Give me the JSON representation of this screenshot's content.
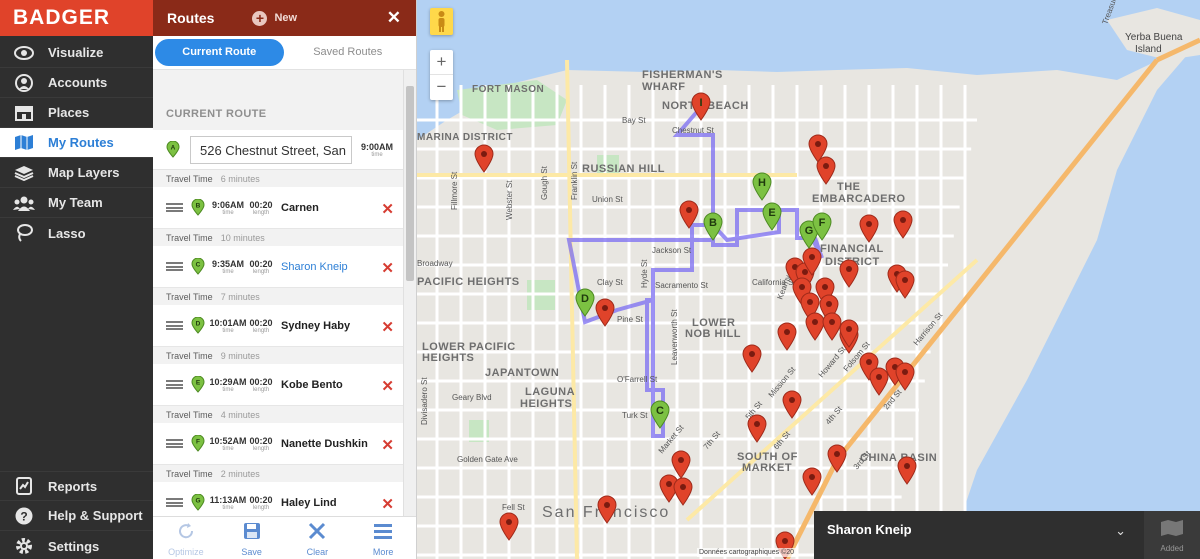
{
  "app": {
    "logo": "BADGER",
    "accent_color": "#e0432a"
  },
  "nav": {
    "items": [
      {
        "label": "Visualize",
        "icon": "eye-icon"
      },
      {
        "label": "Accounts",
        "icon": "user-circle-icon"
      },
      {
        "label": "Places",
        "icon": "storefront-icon"
      },
      {
        "label": "My Routes",
        "icon": "map-icon",
        "active": true
      },
      {
        "label": "Map Layers",
        "icon": "layers-icon"
      },
      {
        "label": "My Team",
        "icon": "team-icon"
      },
      {
        "label": "Lasso",
        "icon": "lasso-icon"
      }
    ],
    "bottom": [
      {
        "label": "Reports",
        "icon": "reports-icon"
      },
      {
        "label": "Help & Support",
        "icon": "help-icon"
      },
      {
        "label": "Settings",
        "icon": "gear-icon"
      }
    ]
  },
  "panel": {
    "title": "Routes",
    "new_label": "New",
    "close_symbol": "✕",
    "tabs": [
      {
        "label": "Current Route",
        "active": true
      },
      {
        "label": "Saved Routes",
        "active": false
      }
    ],
    "section_title": "CURRENT ROUTE",
    "start": {
      "marker": "A",
      "address": "526 Chestnut Street, San",
      "time": "9:00AM",
      "time_sub": "time"
    },
    "travel_label": "Travel Time",
    "stops": [
      {
        "travel": "6 minutes",
        "marker": "B",
        "time": "9:06AM",
        "length": "00:20",
        "name": "Carnen",
        "link": false
      },
      {
        "travel": "10 minutes",
        "marker": "C",
        "time": "9:35AM",
        "length": "00:20",
        "name": "Sharon Kneip",
        "link": true
      },
      {
        "travel": "7 minutes",
        "marker": "D",
        "time": "10:01AM",
        "length": "00:20",
        "name": "Sydney Haby",
        "link": false
      },
      {
        "travel": "9 minutes",
        "marker": "E",
        "time": "10:29AM",
        "length": "00:20",
        "name": "Kobe Bento",
        "link": false
      },
      {
        "travel": "4 minutes",
        "marker": "F",
        "time": "10:52AM",
        "length": "00:20",
        "name": "Nanette Dushkin",
        "link": false
      },
      {
        "travel": "2 minutes",
        "marker": "G",
        "time": "11:13AM",
        "length": "00:20",
        "name": "Haley Lind",
        "link": false
      }
    ],
    "time_sub": "time",
    "length_sub": "length",
    "footer": [
      {
        "label": "Optimize",
        "icon": "refresh-icon",
        "disabled": true
      },
      {
        "label": "Save",
        "icon": "save-icon",
        "disabled": false
      },
      {
        "label": "Clear",
        "icon": "clear-icon",
        "disabled": false
      },
      {
        "label": "More",
        "icon": "menu-icon",
        "disabled": false
      }
    ]
  },
  "map": {
    "zoom_in": "+",
    "zoom_out": "−",
    "attribution": "Données cartographiques ©20",
    "labels": [
      "FISHERMAN'S",
      "WHARF",
      "FORT MASON",
      "NORTH BEACH",
      "MARINA DISTRICT",
      "RUSSIAN HILL",
      "THE",
      "EMBARCADERO",
      "FINANCIAL",
      "DISTRICT",
      "PACIFIC HEIGHTS",
      "LOWER",
      "NOB HILL",
      "LOWER PACIFIC",
      "HEIGHTS",
      "JAPANTOWN",
      "LAGUNA",
      "HEIGHTS",
      "SOUTH OF",
      "MARKET",
      "CHINA BASIN",
      "San Francisco",
      "Yerba Buena",
      "Island",
      "Bay St",
      "Chestnut St",
      "Union St",
      "Jackson St",
      "Clay St",
      "Sacramento St",
      "California St",
      "Pine St",
      "Geary Blvd",
      "O'Farrell St",
      "Turk St",
      "Golden Gate Ave",
      "Fell St",
      "Gough St",
      "Franklin St",
      "Webster St",
      "Fillmore St",
      "Hyde St",
      "Leavenworth St",
      "Kearny St",
      "Howard St",
      "Folsom St",
      "Harrison St",
      "Mission St",
      "Market St",
      "2nd St",
      "4th St",
      "5th St",
      "7th St",
      "6th St",
      "3rd St",
      "Divisadero St",
      "Broadway",
      "Treasure Island Rd"
    ],
    "route_markers": [
      "I",
      "H",
      "E",
      "B",
      "G",
      "F",
      "D",
      "C"
    ],
    "route_color": "#7b6cf2",
    "pin_red": "#e0432a",
    "pin_green": "#7cc142"
  },
  "detail_bar": {
    "name": "Sharon Kneip",
    "chevron": "⌄",
    "added_label": "Added"
  }
}
